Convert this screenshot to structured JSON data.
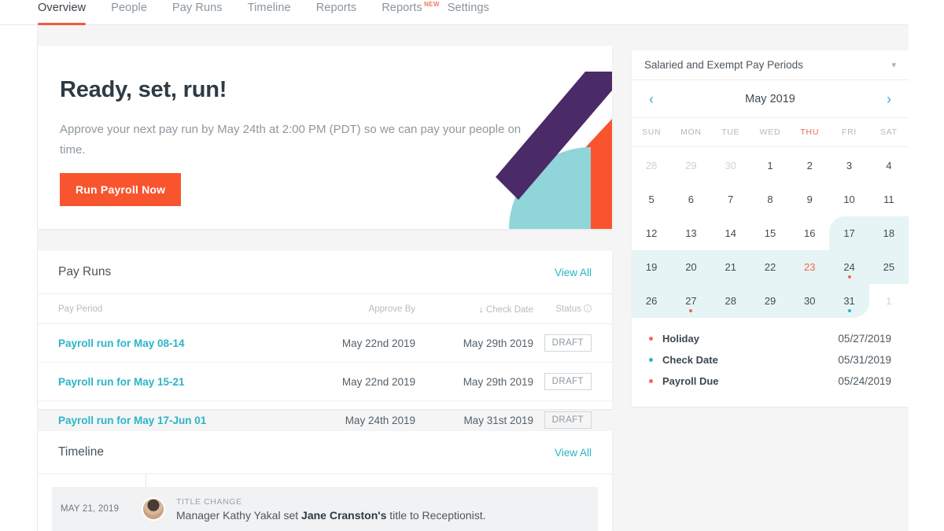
{
  "nav": {
    "items": [
      {
        "label": "Overview",
        "active": true,
        "badge": null
      },
      {
        "label": "People",
        "active": false,
        "badge": null
      },
      {
        "label": "Pay Runs",
        "active": false,
        "badge": null
      },
      {
        "label": "Timeline",
        "active": false,
        "badge": null
      },
      {
        "label": "Reports",
        "active": false,
        "badge": null
      },
      {
        "label": "Reports",
        "active": false,
        "badge": "NEW"
      },
      {
        "label": "Settings",
        "active": false,
        "badge": null
      }
    ]
  },
  "hero": {
    "title": "Ready, set, run!",
    "subtitle": "Approve your next pay run by May 24th at 2:00 PM (PDT) so we can pay your people on time.",
    "button_label": "Run Payroll Now",
    "button_color": "#f8552f",
    "art_colors": {
      "orange": "#f8552f",
      "purple": "#4b2a68",
      "teal": "#8fd5da"
    }
  },
  "payruns": {
    "title": "Pay Runs",
    "view_all": "View All",
    "columns": [
      "Pay Period",
      "Approve By",
      "Check Date",
      "Status"
    ],
    "sort_column": "Check Date",
    "sort_icon": "arrow-down-icon",
    "status_info_icon": "info-icon",
    "rows": [
      {
        "period": "Payroll run for May 08-14",
        "approve_by": "May 22nd 2019",
        "check_date": "May 29th 2019",
        "status": "DRAFT"
      },
      {
        "period": "Payroll run for May 15-21",
        "approve_by": "May 22nd 2019",
        "check_date": "May 29th 2019",
        "status": "DRAFT"
      },
      {
        "period": "Payroll run for May 17-Jun 01",
        "approve_by": "May 24th 2019",
        "check_date": "May 31st 2019",
        "status": "DRAFT"
      }
    ]
  },
  "timeline": {
    "title": "Timeline",
    "view_all": "View All",
    "entries": [
      {
        "date": "MAY 21, 2019",
        "kind": "TITLE CHANGE",
        "text_before": "Manager Kathy Yakal set ",
        "text_bold": "Jane Cranston's",
        "text_after": " title to Receptionist."
      }
    ]
  },
  "calendar": {
    "selected_period": "Salaried and Exempt Pay Periods",
    "dropdown_icon": "chevron-down-icon",
    "prev_icon": "chevron-left-icon",
    "next_icon": "chevron-right-icon",
    "month_label": "May 2019",
    "day_headers": [
      "SUN",
      "MON",
      "TUE",
      "WED",
      "THU",
      "FRI",
      "SAT"
    ],
    "highlighted_day_header": "THU",
    "weeks": [
      [
        {
          "day": "28",
          "muted": true
        },
        {
          "day": "29",
          "muted": true
        },
        {
          "day": "30",
          "muted": true
        },
        {
          "day": "1"
        },
        {
          "day": "2"
        },
        {
          "day": "3"
        },
        {
          "day": "4"
        }
      ],
      [
        {
          "day": "5"
        },
        {
          "day": "6"
        },
        {
          "day": "7"
        },
        {
          "day": "8"
        },
        {
          "day": "9"
        },
        {
          "day": "10"
        },
        {
          "day": "11"
        }
      ],
      [
        {
          "day": "12"
        },
        {
          "day": "13"
        },
        {
          "day": "14"
        },
        {
          "day": "15"
        },
        {
          "day": "16"
        },
        {
          "day": "17"
        },
        {
          "day": "18"
        }
      ],
      [
        {
          "day": "19"
        },
        {
          "day": "20"
        },
        {
          "day": "21"
        },
        {
          "day": "22"
        },
        {
          "day": "23",
          "red": true
        },
        {
          "day": "24",
          "dot": "due"
        },
        {
          "day": "25"
        }
      ],
      [
        {
          "day": "26"
        },
        {
          "day": "27",
          "dot": "holiday"
        },
        {
          "day": "28"
        },
        {
          "day": "29"
        },
        {
          "day": "30"
        },
        {
          "day": "31",
          "dot": "check"
        },
        {
          "day": "1",
          "muted": true
        }
      ]
    ],
    "legend": [
      {
        "name": "Holiday",
        "date": "05/27/2019",
        "color": "#ef6a4b"
      },
      {
        "name": "Check Date",
        "date": "05/31/2019",
        "color": "#2ab5c8"
      },
      {
        "name": "Payroll Due",
        "date": "05/24/2019",
        "color": "#ef6a4b"
      }
    ]
  }
}
